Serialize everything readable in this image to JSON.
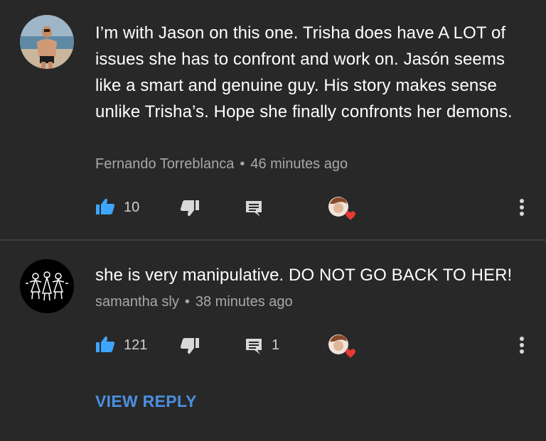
{
  "comments": [
    {
      "text": "I’m with Jason on this one. Trisha does have A LOT of issues she has to confront and work on. Jasón seems like a smart and genuine guy. His story makes sense unlike Trisha’s. Hope she finally confronts her demons.",
      "author": "Fernando Torreblanca",
      "separator": "•",
      "time": "46 minutes ago",
      "likes": "10",
      "replies": ""
    },
    {
      "text": "she is very manipulative. DO NOT GO BACK TO HER!",
      "author": "samantha sly",
      "separator": "•",
      "time": "38 minutes ago",
      "likes": "121",
      "replies": "1",
      "view_reply_label": "VIEW REPLY"
    }
  ],
  "colors": {
    "background": "#282828",
    "like_blue": "#3ea6ff",
    "view_reply_blue": "#4b8fe0",
    "heart_red": "#e53935"
  },
  "icons": [
    "like-icon",
    "dislike-icon",
    "reply-icon",
    "creator-heart-icon",
    "more-options-icon"
  ]
}
